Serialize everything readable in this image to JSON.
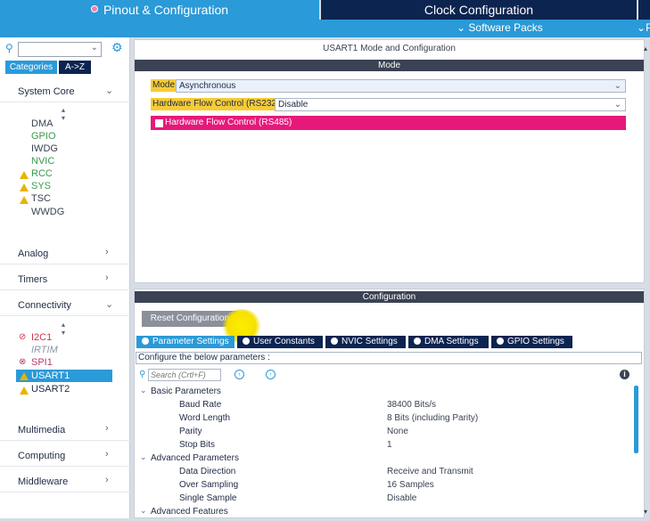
{
  "tabs": {
    "pinout": "Pinout & Configuration",
    "clock": "Clock Configuration",
    "software_packs": "Software Packs",
    "more": "P"
  },
  "left": {
    "search_placeholder": "",
    "categories_btn": "Categories",
    "az_btn": "A->Z",
    "groups": {
      "system_core": "System Core",
      "analog": "Analog",
      "timers": "Timers",
      "connectivity": "Connectivity",
      "multimedia": "Multimedia",
      "computing": "Computing",
      "middleware": "Middleware"
    },
    "system_items": [
      "DMA",
      "GPIO",
      "IWDG",
      "NVIC",
      "RCC",
      "SYS",
      "TSC",
      "WWDG"
    ],
    "connectivity_items": [
      "I2C1",
      "IRTIM",
      "SPI1",
      "USART1",
      "USART2"
    ]
  },
  "mode_panel": {
    "title": "USART1 Mode and Configuration",
    "header": "Mode",
    "mode_label": "Mode",
    "mode_value": "Asynchronous",
    "rs232_label": "Hardware Flow Control (RS232)",
    "rs232_value": "Disable",
    "rs485_label": "Hardware Flow Control (RS485)"
  },
  "config_panel": {
    "header": "Configuration",
    "reset_btn": "Reset Configuration",
    "tabs": [
      "Parameter Settings",
      "User Constants",
      "NVIC Settings",
      "DMA Settings",
      "GPIO Settings"
    ],
    "hint": "Configure the below parameters :",
    "search_placeholder": "Search (Crtl+F)",
    "basic_group": "Basic Parameters",
    "advanced_group": "Advanced Parameters",
    "advanced_features": "Advanced Features",
    "params": [
      {
        "name": "Baud Rate",
        "value": "38400 Bits/s"
      },
      {
        "name": "Word Length",
        "value": "8 Bits (including Parity)"
      },
      {
        "name": "Parity",
        "value": "None"
      },
      {
        "name": "Stop Bits",
        "value": "1"
      },
      {
        "name": "Data Direction",
        "value": "Receive and Transmit"
      },
      {
        "name": "Over Sampling",
        "value": "16 Samples"
      },
      {
        "name": "Single Sample",
        "value": "Disable"
      }
    ]
  },
  "colors": {
    "accent": "#2a9ad8",
    "navy": "#0c2450",
    "warning": "#e8b400",
    "rs485": "#e6197a",
    "highlight": "#f5cc36"
  }
}
